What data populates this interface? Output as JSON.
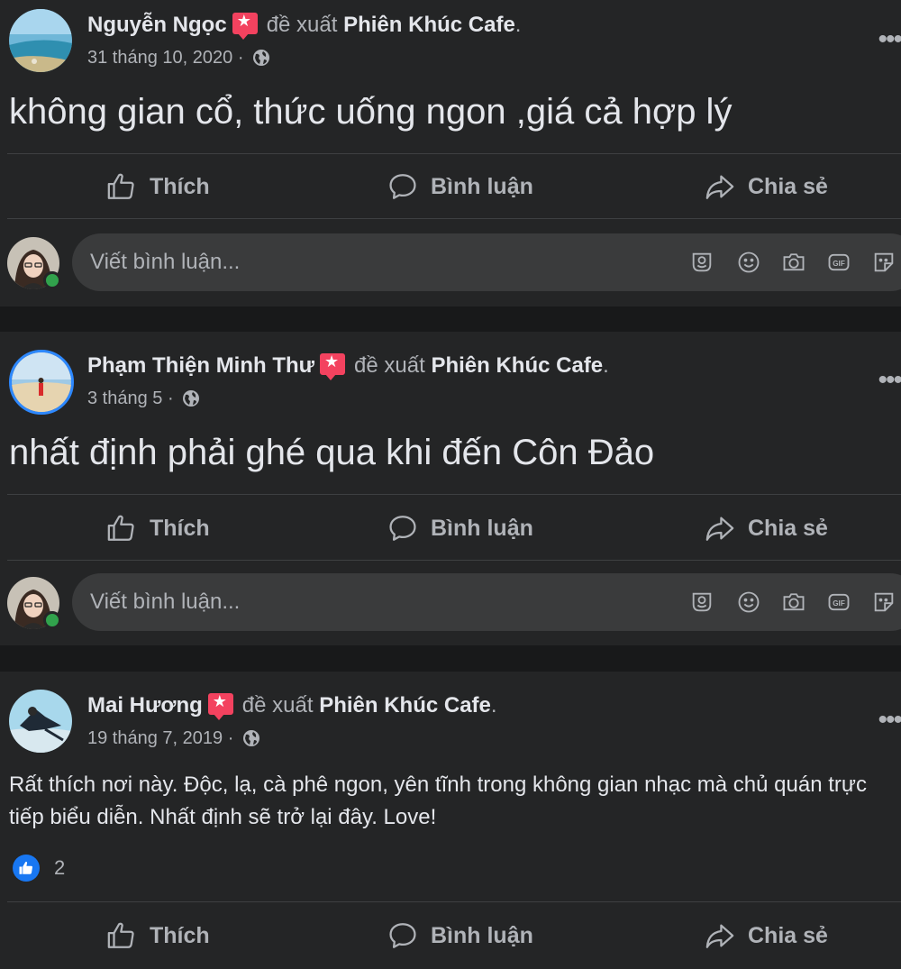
{
  "icons": {
    "recommend": "recommend-star-icon",
    "audience": "globe-icon",
    "more": "more-options-icon",
    "like": "thumb-up-icon",
    "comment": "comment-bubble-icon",
    "share": "share-arrow-icon",
    "sticker_toolbar": [
      "avatar-sticker-icon",
      "emoji-icon",
      "camera-icon",
      "gif-icon",
      "sticker-icon"
    ]
  },
  "colors": {
    "background": "#18191a",
    "card": "#242526",
    "input": "#3a3b3c",
    "text_primary": "#e4e6eb",
    "text_secondary": "#b0b3b8",
    "recommend_red": "#f3425f",
    "like_blue": "#1877f2",
    "online_green": "#31a24c"
  },
  "actions": {
    "like": "Thích",
    "comment": "Bình luận",
    "share": "Chia sẻ"
  },
  "comment_placeholder": "Viết bình luận...",
  "posts": [
    {
      "author": "Nguyễn Ngọc",
      "verb": "đề xuất",
      "page": "Phiên Khúc Cafe",
      "period": ".",
      "date": "31 tháng 10, 2020 ·",
      "text": "không gian cổ, thức uống ngon ,giá cả hợp lý"
    },
    {
      "author": "Phạm Thiện Minh Thư",
      "verb": "đề xuất",
      "page": "Phiên Khúc Cafe",
      "period": ".",
      "date": "3 tháng 5 ·",
      "text": "nhất định phải ghé qua khi đến Côn Đảo"
    },
    {
      "author": "Mai Hương",
      "verb": "đề xuất",
      "page": "Phiên Khúc Cafe",
      "period": ".",
      "date": "19 tháng 7, 2019 ·",
      "text": "Rất thích nơi này. Độc, lạ, cà phê ngon, yên tĩnh trong không gian nhạc mà chủ quán trực tiếp biểu diễn. Nhất định sẽ trở lại đây. Love!",
      "reaction_count": "2"
    }
  ]
}
